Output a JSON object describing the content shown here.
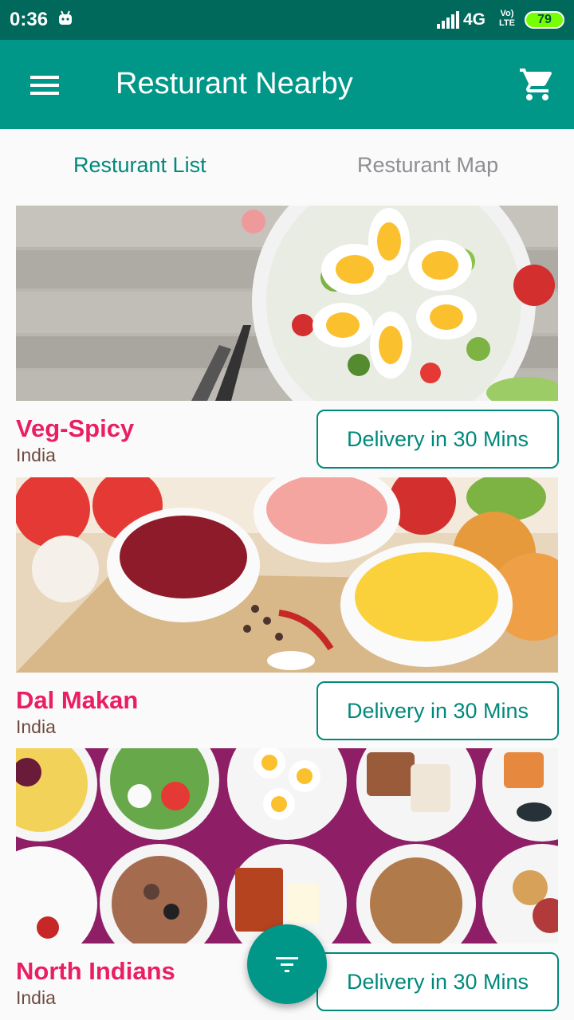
{
  "status_bar": {
    "time": "0:36",
    "network": "4G",
    "volte_line1": "Vo)",
    "volte_line2": "LTE",
    "battery": "79"
  },
  "app_bar": {
    "title": "Resturant Nearby",
    "menu_icon": "hamburger-menu-icon",
    "cart_icon": "shopping-cart-icon"
  },
  "tabs": [
    {
      "label": "Resturant List",
      "active": true
    },
    {
      "label": "Resturant Map",
      "active": false
    }
  ],
  "restaurants": [
    {
      "name": "Veg-Spicy",
      "country": "India",
      "delivery": "Delivery in 30 Mins"
    },
    {
      "name": "Dal Makan",
      "country": "India",
      "delivery": "Delivery in 30 Mins"
    },
    {
      "name": "North Indians",
      "country": "India",
      "delivery": "Delivery in 30 Mins"
    }
  ],
  "fab": {
    "icon": "filter-icon"
  },
  "colors": {
    "primary": "#009688",
    "primary_dark": "#00695c",
    "accent_text": "#00897b",
    "restaurant_name": "#e91e63"
  }
}
